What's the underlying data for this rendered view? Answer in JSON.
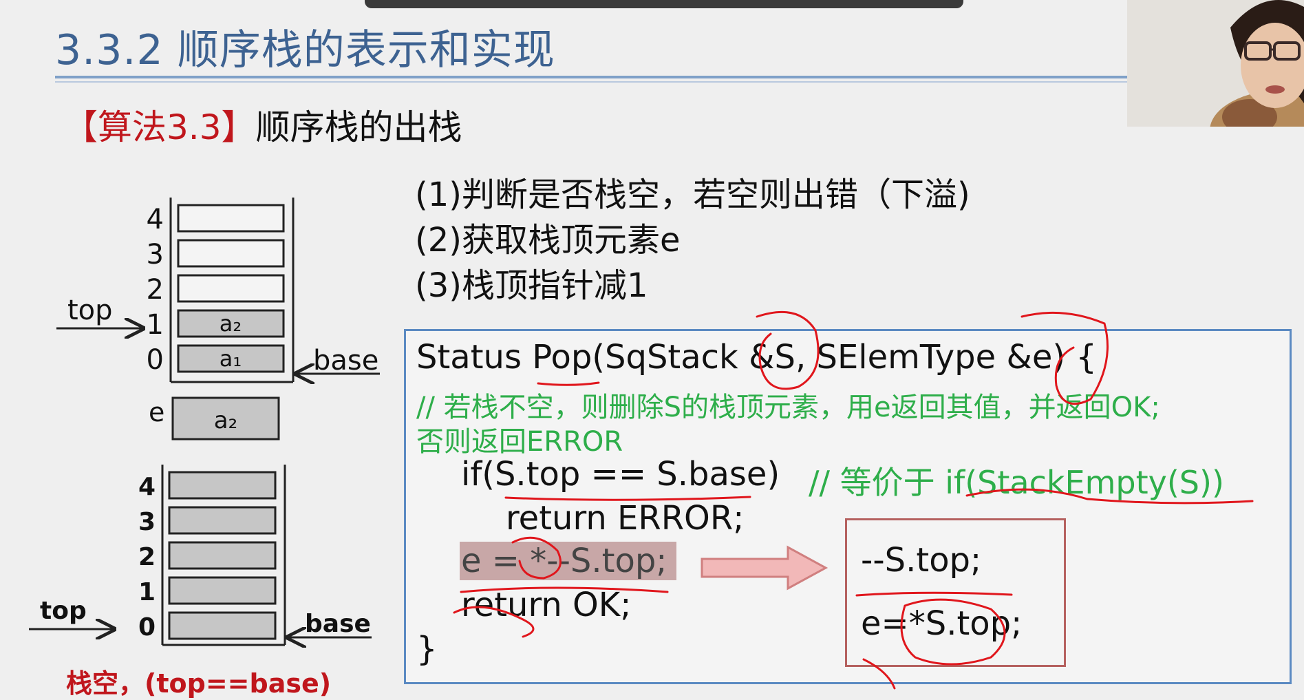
{
  "slide": {
    "title": "3.3.2 顺序栈的表示和实现",
    "algo_tag": "【算法3.3】",
    "algo_name": "顺序栈的出栈"
  },
  "steps": [
    "(1)判断是否栈空，若空则出错（下溢)",
    "(2)获取栈顶元素e",
    "(3)栈顶指针减1"
  ],
  "code": {
    "signature": "Status Pop(SqStack &S, SElemType &e) {",
    "comment1": "// 若栈不空，则删除S的栈顶元素，用e返回其值，并返回OK;",
    "comment2": "否则返回ERROR",
    "if_stmt": "if(S.top == S.base)",
    "if_comment": "// 等价于 if(StackEmpty(S))",
    "return_error": "return ERROR;",
    "pop_stmt": "e = *--S.top;",
    "return_ok": "return OK;",
    "close_brace": "}"
  },
  "equivalent": {
    "line1": "--S.top;",
    "line2": "e=*S.top;"
  },
  "diagram_top": {
    "indices": [
      "4",
      "3",
      "2",
      "1",
      "0"
    ],
    "cells": [
      "",
      "",
      "",
      "a₂",
      "a₁"
    ],
    "top_label": "top",
    "base_label": "base",
    "e_label": "e",
    "e_value": "a₂"
  },
  "diagram_bottom": {
    "indices": [
      "4",
      "3",
      "2",
      "1",
      "0"
    ],
    "top_label": "top",
    "base_label": "base"
  },
  "caption": "栈空，(top==base)",
  "colors": {
    "title": "#3d6291",
    "red": "#c0161c",
    "comment_green": "#2eae4a",
    "code_border": "#5b8ac2",
    "side_border": "#b5615f",
    "cell_filled": "#c6c6c6",
    "ink": "#e0161c"
  }
}
